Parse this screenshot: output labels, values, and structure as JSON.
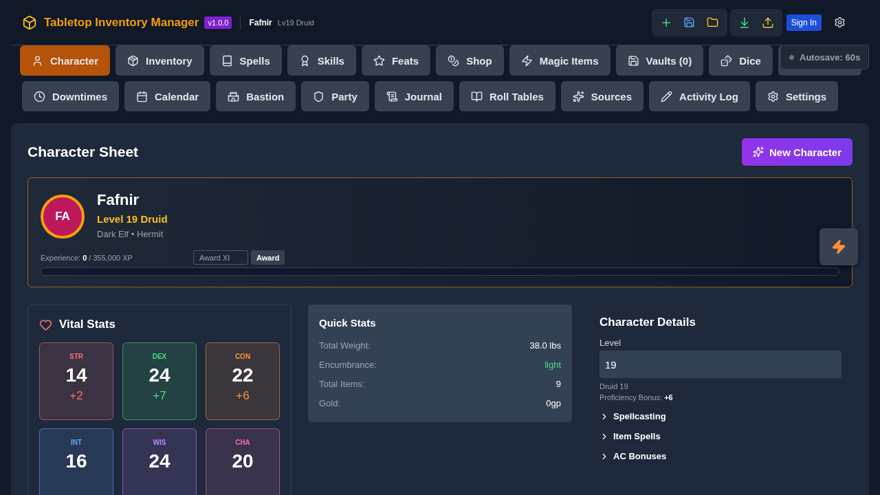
{
  "header": {
    "title": "Tabletop Inventory Manager",
    "version": "v1.0.0",
    "character_name": "Fafnir",
    "character_summary": "Lv19 Druid",
    "sign_in": "Sign In"
  },
  "autosave": {
    "label": "Autosave: 60s"
  },
  "tabs": [
    {
      "label": "Character",
      "selected": true
    },
    {
      "label": "Inventory",
      "selected": false
    },
    {
      "label": "Spells",
      "selected": false
    },
    {
      "label": "Skills",
      "selected": false
    },
    {
      "label": "Feats",
      "selected": false
    },
    {
      "label": "Shop",
      "selected": false
    },
    {
      "label": "Magic Items",
      "selected": false
    },
    {
      "label": "Vaults (0)",
      "selected": false
    },
    {
      "label": "Dice",
      "selected": false
    },
    {
      "selected": false
    },
    {
      "label": "Downtimes",
      "selected": false
    },
    {
      "label": "Calendar",
      "selected": false
    },
    {
      "label": "Bastion",
      "selected": false
    },
    {
      "label": "Party",
      "selected": false
    },
    {
      "label": "Journal",
      "selected": false
    },
    {
      "label": "Roll Tables",
      "selected": false
    },
    {
      "label": "Sources",
      "selected": false
    },
    {
      "label": "Activity Log",
      "selected": false
    },
    {
      "label": "Settings",
      "selected": false
    }
  ],
  "page": {
    "title": "Character Sheet",
    "new_button": "New Character"
  },
  "profile": {
    "initials": "FA",
    "name": "Fafnir",
    "class_line": "Level 19 Druid",
    "origin": "Dark Elf • Hermit",
    "experience": "Experience: **0** / 355,000 XP",
    "award_placeholder": "Award XI",
    "award_button": "Award"
  },
  "vital_stats": {
    "title": "Vital Stats",
    "stats": [
      {
        "abbr": "STR",
        "score": "14",
        "mod": "+2",
        "color": "#f87171"
      },
      {
        "abbr": "DEX",
        "score": "24",
        "mod": "+7",
        "color": "#4ade80"
      },
      {
        "abbr": "CON",
        "score": "22",
        "mod": "+6",
        "color": "#fb923c"
      },
      {
        "abbr": "INT",
        "score": "16",
        "color": "#60a5fa"
      },
      {
        "abbr": "WIS",
        "score": "24",
        "color": "#c084fc"
      },
      {
        "abbr": "CHA",
        "score": "20",
        "color": "#f472b6"
      }
    ]
  },
  "quick_stats": {
    "title": "Quick Stats",
    "rows": [
      {
        "label": "Total Weight:",
        "value": "38.0 lbs",
        "kind": "plain"
      },
      {
        "label": "Encumbrance:",
        "value": "light",
        "kind": "status"
      },
      {
        "label": "Total Items:",
        "value": "9",
        "kind": "plain"
      },
      {
        "label": "Gold:",
        "value": "0gp",
        "kind": "plain"
      }
    ]
  },
  "character_details": {
    "title": "Character Details",
    "level_label": "Level",
    "level_value": "19",
    "class_summary": "Druid 19",
    "proficiency": "Proficiency Bonus: **+6**",
    "sections": [
      {
        "label": "Spellcasting",
        "expanded": false
      },
      {
        "label": "Item Spells",
        "expanded": false
      },
      {
        "label": "AC Bonuses",
        "expanded": false
      }
    ]
  }
}
